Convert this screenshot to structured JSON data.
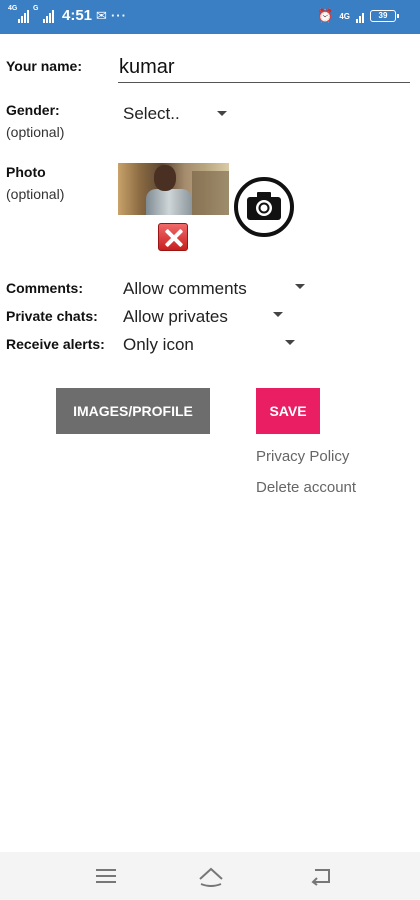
{
  "status_bar": {
    "time": "4:51",
    "network_left_1": "4G",
    "network_left_2": "G",
    "network_right": "4G",
    "battery_level": "39",
    "more_icon": "dots-icon",
    "alarm_icon": "alarm-icon"
  },
  "form": {
    "name_label": "Your name:",
    "name_value": "kumar",
    "gender_label": "Gender:",
    "gender_sub": "(optional)",
    "gender_value": "Select..",
    "photo_label": "Photo",
    "photo_sub": "(optional)",
    "comments_label": "Comments:",
    "comments_value": "Allow comments",
    "private_chats_label": "Private chats:",
    "private_chats_value": "Allow privates",
    "receive_alerts_label": "Receive alerts:",
    "receive_alerts_value": "Only icon"
  },
  "actions": {
    "images_profile_label": "IMAGES/PROFILE",
    "save_label": "SAVE",
    "privacy_policy_label": "Privacy Policy",
    "delete_account_label": "Delete account"
  },
  "colors": {
    "status_bar": "#3a7fc4",
    "save_button": "#e91e63",
    "images_button": "#6d6d6d"
  }
}
